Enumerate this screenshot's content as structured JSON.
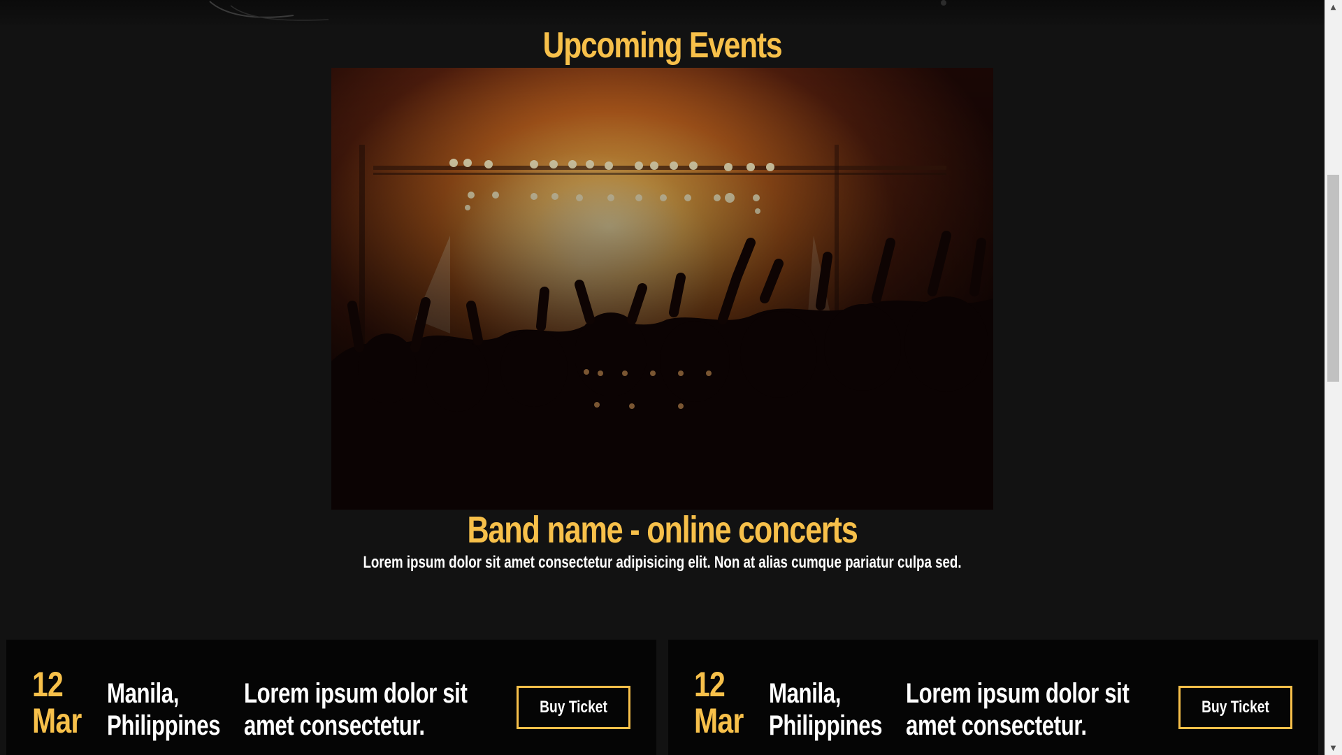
{
  "section": {
    "title": "Upcoming Events"
  },
  "hero": {
    "image_alt": "concert crowd with stage lights"
  },
  "event": {
    "title": "Band name - online concerts",
    "description": "Lorem ipsum dolor sit amet consectetur adipisicing elit. Non at alias cumque pariatur culpa sed."
  },
  "cards": [
    {
      "day": "12",
      "month": "Mar",
      "location_line1": "Manila,",
      "location_line2": "Philippines",
      "text_line1": "Lorem ipsum dolor sit",
      "text_line2": "amet consectetur.",
      "button": "Buy Ticket"
    },
    {
      "day": "12",
      "month": "Mar",
      "location_line1": "Manila,",
      "location_line2": "Philippines",
      "text_line1": "Lorem ipsum dolor sit",
      "text_line2": "amet consectetur.",
      "button": "Buy Ticket"
    }
  ],
  "colors": {
    "accent": "#f7c04a",
    "background": "#121212",
    "card": "#050505",
    "text": "#ffffff"
  },
  "icons": {
    "scroll_up": "triangle-up-icon",
    "scroll_down": "triangle-down-icon"
  }
}
